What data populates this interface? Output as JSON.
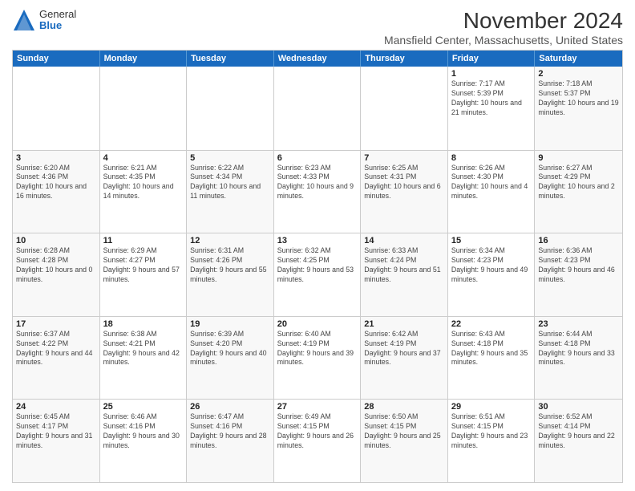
{
  "logo": {
    "general": "General",
    "blue": "Blue"
  },
  "title": "November 2024",
  "location": "Mansfield Center, Massachusetts, United States",
  "header_days": [
    "Sunday",
    "Monday",
    "Tuesday",
    "Wednesday",
    "Thursday",
    "Friday",
    "Saturday"
  ],
  "weeks": [
    [
      {
        "day": "",
        "info": ""
      },
      {
        "day": "",
        "info": ""
      },
      {
        "day": "",
        "info": ""
      },
      {
        "day": "",
        "info": ""
      },
      {
        "day": "",
        "info": ""
      },
      {
        "day": "1",
        "info": "Sunrise: 7:17 AM\nSunset: 5:39 PM\nDaylight: 10 hours and 21 minutes."
      },
      {
        "day": "2",
        "info": "Sunrise: 7:18 AM\nSunset: 5:37 PM\nDaylight: 10 hours and 19 minutes."
      }
    ],
    [
      {
        "day": "3",
        "info": "Sunrise: 6:20 AM\nSunset: 4:36 PM\nDaylight: 10 hours and 16 minutes."
      },
      {
        "day": "4",
        "info": "Sunrise: 6:21 AM\nSunset: 4:35 PM\nDaylight: 10 hours and 14 minutes."
      },
      {
        "day": "5",
        "info": "Sunrise: 6:22 AM\nSunset: 4:34 PM\nDaylight: 10 hours and 11 minutes."
      },
      {
        "day": "6",
        "info": "Sunrise: 6:23 AM\nSunset: 4:33 PM\nDaylight: 10 hours and 9 minutes."
      },
      {
        "day": "7",
        "info": "Sunrise: 6:25 AM\nSunset: 4:31 PM\nDaylight: 10 hours and 6 minutes."
      },
      {
        "day": "8",
        "info": "Sunrise: 6:26 AM\nSunset: 4:30 PM\nDaylight: 10 hours and 4 minutes."
      },
      {
        "day": "9",
        "info": "Sunrise: 6:27 AM\nSunset: 4:29 PM\nDaylight: 10 hours and 2 minutes."
      }
    ],
    [
      {
        "day": "10",
        "info": "Sunrise: 6:28 AM\nSunset: 4:28 PM\nDaylight: 10 hours and 0 minutes."
      },
      {
        "day": "11",
        "info": "Sunrise: 6:29 AM\nSunset: 4:27 PM\nDaylight: 9 hours and 57 minutes."
      },
      {
        "day": "12",
        "info": "Sunrise: 6:31 AM\nSunset: 4:26 PM\nDaylight: 9 hours and 55 minutes."
      },
      {
        "day": "13",
        "info": "Sunrise: 6:32 AM\nSunset: 4:25 PM\nDaylight: 9 hours and 53 minutes."
      },
      {
        "day": "14",
        "info": "Sunrise: 6:33 AM\nSunset: 4:24 PM\nDaylight: 9 hours and 51 minutes."
      },
      {
        "day": "15",
        "info": "Sunrise: 6:34 AM\nSunset: 4:23 PM\nDaylight: 9 hours and 49 minutes."
      },
      {
        "day": "16",
        "info": "Sunrise: 6:36 AM\nSunset: 4:23 PM\nDaylight: 9 hours and 46 minutes."
      }
    ],
    [
      {
        "day": "17",
        "info": "Sunrise: 6:37 AM\nSunset: 4:22 PM\nDaylight: 9 hours and 44 minutes."
      },
      {
        "day": "18",
        "info": "Sunrise: 6:38 AM\nSunset: 4:21 PM\nDaylight: 9 hours and 42 minutes."
      },
      {
        "day": "19",
        "info": "Sunrise: 6:39 AM\nSunset: 4:20 PM\nDaylight: 9 hours and 40 minutes."
      },
      {
        "day": "20",
        "info": "Sunrise: 6:40 AM\nSunset: 4:19 PM\nDaylight: 9 hours and 39 minutes."
      },
      {
        "day": "21",
        "info": "Sunrise: 6:42 AM\nSunset: 4:19 PM\nDaylight: 9 hours and 37 minutes."
      },
      {
        "day": "22",
        "info": "Sunrise: 6:43 AM\nSunset: 4:18 PM\nDaylight: 9 hours and 35 minutes."
      },
      {
        "day": "23",
        "info": "Sunrise: 6:44 AM\nSunset: 4:18 PM\nDaylight: 9 hours and 33 minutes."
      }
    ],
    [
      {
        "day": "24",
        "info": "Sunrise: 6:45 AM\nSunset: 4:17 PM\nDaylight: 9 hours and 31 minutes."
      },
      {
        "day": "25",
        "info": "Sunrise: 6:46 AM\nSunset: 4:16 PM\nDaylight: 9 hours and 30 minutes."
      },
      {
        "day": "26",
        "info": "Sunrise: 6:47 AM\nSunset: 4:16 PM\nDaylight: 9 hours and 28 minutes."
      },
      {
        "day": "27",
        "info": "Sunrise: 6:49 AM\nSunset: 4:15 PM\nDaylight: 9 hours and 26 minutes."
      },
      {
        "day": "28",
        "info": "Sunrise: 6:50 AM\nSunset: 4:15 PM\nDaylight: 9 hours and 25 minutes."
      },
      {
        "day": "29",
        "info": "Sunrise: 6:51 AM\nSunset: 4:15 PM\nDaylight: 9 hours and 23 minutes."
      },
      {
        "day": "30",
        "info": "Sunrise: 6:52 AM\nSunset: 4:14 PM\nDaylight: 9 hours and 22 minutes."
      }
    ]
  ]
}
